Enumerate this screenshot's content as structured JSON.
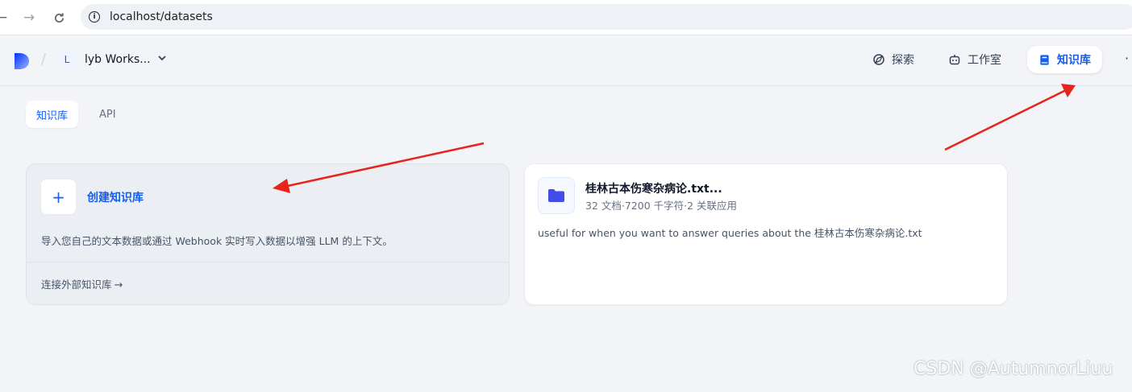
{
  "browser": {
    "url": "localhost/datasets"
  },
  "header": {
    "workspace_initial": "L",
    "workspace_name": "lyb Works...",
    "nav": {
      "explore": "探索",
      "studio": "工作室",
      "knowledge": "知识库"
    }
  },
  "tabs": {
    "knowledge": "知识库",
    "api": "API"
  },
  "create_card": {
    "plus": "+",
    "title": "创建知识库",
    "description": "导入您自己的文本数据或通过 Webhook 实时写入数据以增强 LLM 的上下文。",
    "external_link": "连接外部知识库"
  },
  "dataset_card": {
    "name": "桂林古本伤寒杂病论.txt...",
    "meta": "32 文档·7200 千字符·2 关联应用",
    "description": "useful for when you want to answer queries about the 桂林古本伤寒杂病论.txt"
  },
  "watermark": "CSDN @AutumnorLiuu",
  "colors": {
    "accent": "#155eef",
    "annotation_arrow": "#e8231c",
    "folder": "#444ce7"
  }
}
